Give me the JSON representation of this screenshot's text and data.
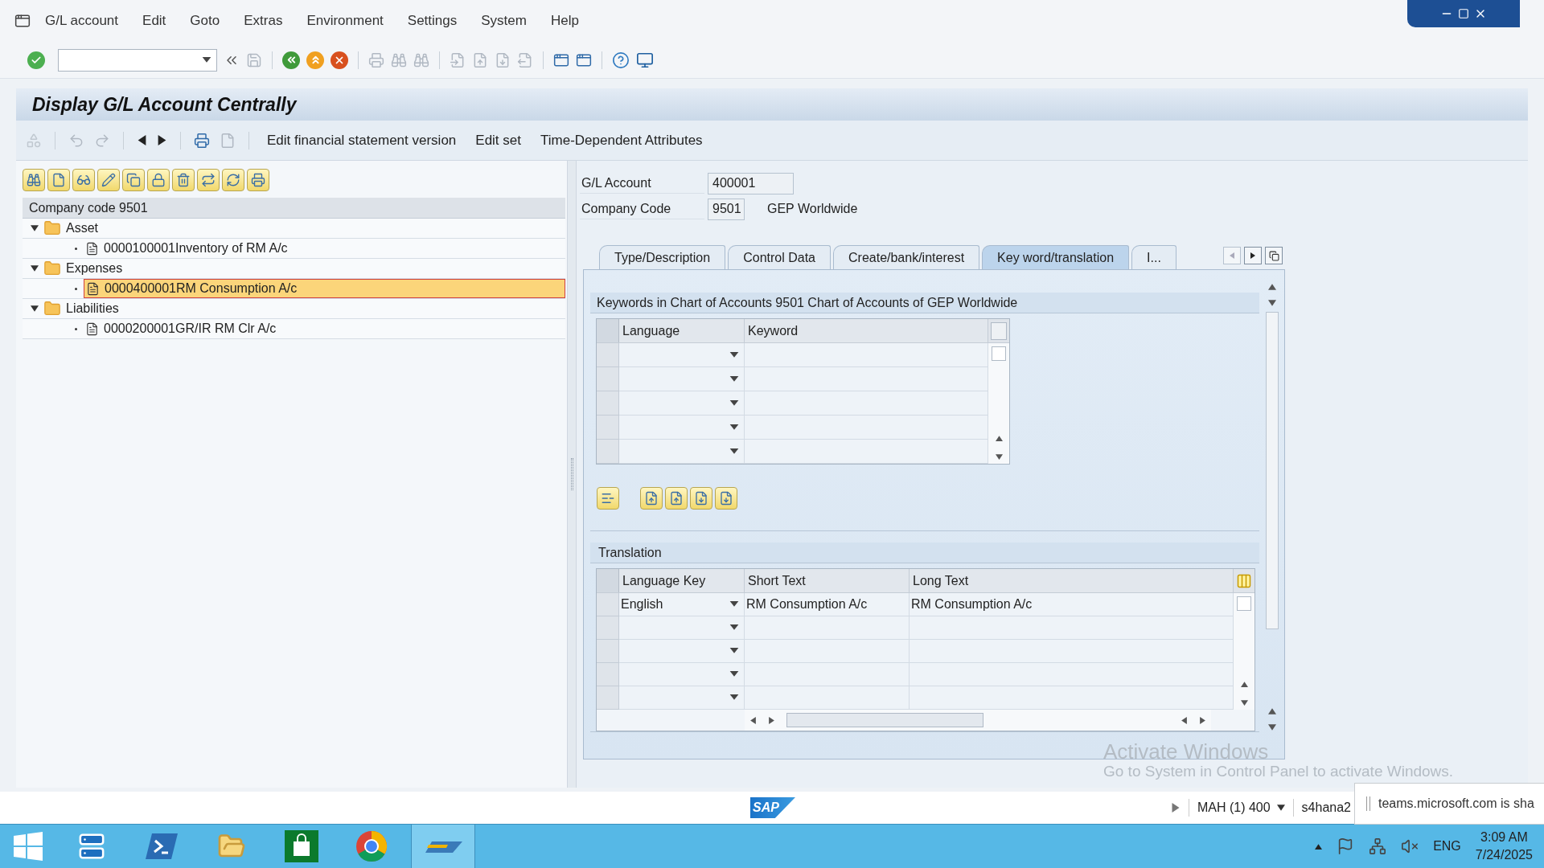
{
  "menu": [
    "G/L account",
    "Edit",
    "Goto",
    "Extras",
    "Environment",
    "Settings",
    "System",
    "Help"
  ],
  "title": "Display G/L Account Centrally",
  "app_toolbar": [
    "Edit financial statement version",
    "Edit set",
    "Time-Dependent Attributes"
  ],
  "tree": {
    "header": "Company code 9501",
    "nodes": [
      {
        "label": "Asset",
        "expanded": true,
        "selected": false,
        "children": [
          {
            "label": "0000100001Inventory of RM A/c",
            "selected": false
          }
        ]
      },
      {
        "label": "Expenses",
        "expanded": true,
        "selected": false,
        "children": [
          {
            "label": "0000400001RM Consumption A/c",
            "selected": true
          }
        ]
      },
      {
        "label": "Liabilities",
        "expanded": true,
        "selected": false,
        "children": [
          {
            "label": "0000200001GR/IR RM Clr A/c",
            "selected": false
          }
        ]
      }
    ]
  },
  "header_fields": [
    {
      "label": "G/L Account",
      "value": "400001"
    },
    {
      "label": "Company Code",
      "value": "9501",
      "description": "GEP Worldwide"
    }
  ],
  "tabs": [
    {
      "label": "Type/Description",
      "selected": false
    },
    {
      "label": "Control Data",
      "selected": false
    },
    {
      "label": "Create/bank/interest",
      "selected": false
    },
    {
      "label": "Key word/translation",
      "selected": true
    },
    {
      "label": "I...",
      "selected": false
    }
  ],
  "keywords": {
    "title": "Keywords in Chart of Accounts 9501 Chart of Accounts of  GEP Worldwide",
    "columns": [
      "Language",
      "Keyword"
    ]
  },
  "translation": {
    "title": "Translation",
    "columns": [
      "Language Key",
      "Short Text",
      "Long Text"
    ],
    "rows": [
      {
        "language_key": "English",
        "short_text": "RM Consumption A/c",
        "long_text": "RM Consumption A/c"
      }
    ]
  },
  "activation_notice": {
    "title": "Activate Windows",
    "text": "Go to System in Control Panel to activate Windows."
  },
  "status_bar": {
    "logo": "SAP",
    "system": "MAH (1) 400",
    "server": "s4hana2"
  },
  "notification": "teams.microsoft.com is sha",
  "taskbar": {
    "language": "ENG",
    "time": "3:09 AM",
    "date": "7/24/2025"
  }
}
